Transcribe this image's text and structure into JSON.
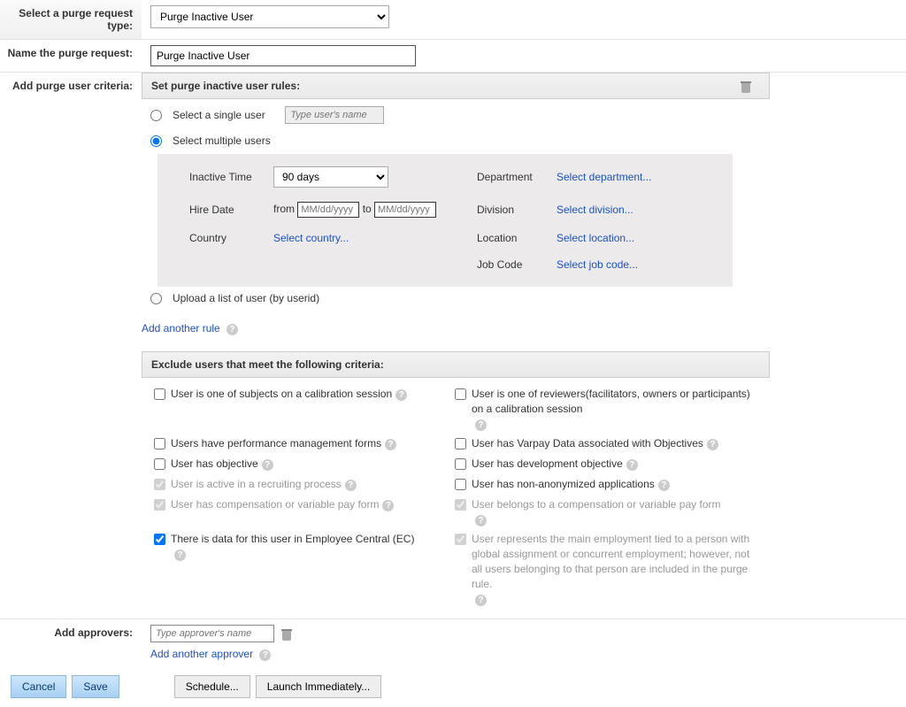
{
  "labels": {
    "request_type": "Select a purge request type:",
    "name_request": "Name the purge request:",
    "add_criteria": "Add purge user criteria:",
    "add_approvers": "Add approvers:"
  },
  "request_type": {
    "selected": "Purge Inactive User"
  },
  "name_value": "Purge Inactive User",
  "rules_header": "Set purge inactive user rules:",
  "selection": {
    "single_label": "Select a single user",
    "multiple_label": "Select multiple users",
    "upload_label": "Upload a list of user (by userid)",
    "user_name_placeholder": "Type user's name"
  },
  "criteria": {
    "inactive_label": "Inactive Time",
    "inactive_value": "90 days",
    "hire_label": "Hire Date",
    "from": "from",
    "to": "to",
    "date_placeholder": "MM/dd/yyyy",
    "country_label": "Country",
    "country_link": "Select country...",
    "department_label": "Department",
    "department_link": "Select department...",
    "division_label": "Division",
    "division_link": "Select division...",
    "location_label": "Location",
    "location_link": "Select location...",
    "jobcode_label": "Job Code",
    "jobcode_link": "Select job code..."
  },
  "add_rule_link": "Add another rule",
  "exclude_header": "Exclude users that meet the following criteria:",
  "exclude": {
    "calib_subject": "User is one of subjects on a calibration session",
    "calib_reviewer": "User is one of reviewers(facilitators, owners or participants) on a calibration session",
    "perf_forms": "Users have performance management forms",
    "varpay": "User has Varpay Data associated with Objectives",
    "has_objective": "User has objective",
    "dev_objective": "User has development objective",
    "recruiting": "User is active in a recruiting process",
    "non_anon": "User has non-anonymized applications",
    "comp_form": "User has compensation or variable pay form",
    "belongs_comp": "User belongs to a compensation or variable pay form",
    "ec_data": "There is data for this user in Employee Central (EC)",
    "main_employment": "User represents the main employment tied to a person with global assignment or concurrent employment; however, not all users belonging to that person are included in the purge rule."
  },
  "approvers": {
    "placeholder": "Type approver's name",
    "add_link": "Add another approver"
  },
  "buttons": {
    "cancel": "Cancel",
    "save": "Save",
    "schedule": "Schedule...",
    "launch": "Launch Immediately..."
  }
}
